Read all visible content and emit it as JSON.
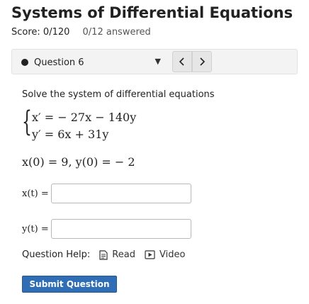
{
  "header": {
    "title": "Systems of Differential Equations",
    "score": "Score: 0/120",
    "answered": "0/12 answered"
  },
  "question_nav": {
    "selected": "Question 6",
    "prev_icon": "chevron-left-icon",
    "next_icon": "chevron-right-icon",
    "dropdown_icon": "caret-down-icon"
  },
  "question": {
    "prompt": "Solve the system of differential equations",
    "eq1": "x′ = − 27x − 140y",
    "eq2": "y′ = 6x + 31y",
    "initial": "x(0) = 9,  y(0) = − 2",
    "x_label": "x(t) =",
    "y_label": "y(t) =",
    "x_value": "",
    "y_value": ""
  },
  "help": {
    "label": "Question Help:",
    "read": "Read",
    "video": "Video"
  },
  "submit_label": "Submit Question",
  "colors": {
    "accent": "#2f6db5",
    "nav_bg": "#f3f3f3"
  }
}
